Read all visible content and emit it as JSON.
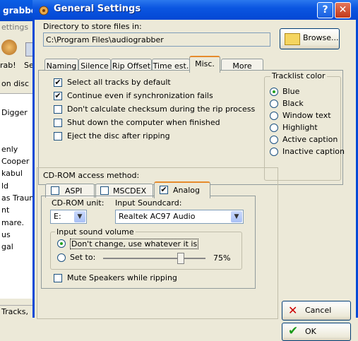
{
  "background_app": {
    "title": "grabber",
    "menu_item": "ettings",
    "toolbar": {
      "grab_label": "rab!",
      "set_label": "Se"
    },
    "ondisc_label": "on disc",
    "list_items": [
      "Digger",
      "enly",
      "Cooper",
      "kabul",
      "ld",
      "as Traum",
      "nt",
      "mare.",
      "us",
      "gal"
    ],
    "status_text": "Tracks,"
  },
  "dialog": {
    "title": "General Settings",
    "help_label": "?",
    "close_label": "✕",
    "directory": {
      "label": "Directory to store files in:",
      "value": "C:\\Program Files\\audiograbber",
      "browse_label": "Browse..."
    },
    "tabs": [
      {
        "label": "Naming"
      },
      {
        "label": "Silence"
      },
      {
        "label": "Rip Offset"
      },
      {
        "label": "Time est."
      },
      {
        "label": "Misc."
      },
      {
        "label": "More misc."
      }
    ],
    "misc_options": [
      {
        "label": "Select all tracks by default",
        "checked": true
      },
      {
        "label": "Continue even if synchronization fails",
        "checked": true
      },
      {
        "label": "Don't calculate checksum during the rip process",
        "checked": false
      },
      {
        "label": "Shut down the computer when finished",
        "checked": false
      },
      {
        "label": "Eject the disc after ripping",
        "checked": false
      }
    ],
    "tracklist_color": {
      "legend": "Tracklist color",
      "options": [
        "Blue",
        "Black",
        "Window text",
        "Highlight",
        "Active caption",
        "Inactive caption"
      ],
      "selected": "Blue"
    },
    "cdrom": {
      "legend": "CD-ROM access method:",
      "tabs": [
        {
          "label": "ASPI",
          "checked": false
        },
        {
          "label": "MSCDEX",
          "checked": false
        },
        {
          "label": "Analog",
          "checked": true
        }
      ],
      "unit_label": "CD-ROM unit:",
      "unit_value": "E:",
      "soundcard_label": "Input Soundcard:",
      "soundcard_value": "Realtek AC97 Audio",
      "volume": {
        "legend": "Input sound volume",
        "option_dont_change": "Don't change, use whatever it is",
        "option_set_to": "Set to:",
        "selected": "dont_change",
        "percent_label": "75%",
        "level": 0.75
      },
      "mute_label": "Mute Speakers while ripping",
      "mute_checked": false
    },
    "cancel_label": "Cancel",
    "ok_label": "OK"
  }
}
